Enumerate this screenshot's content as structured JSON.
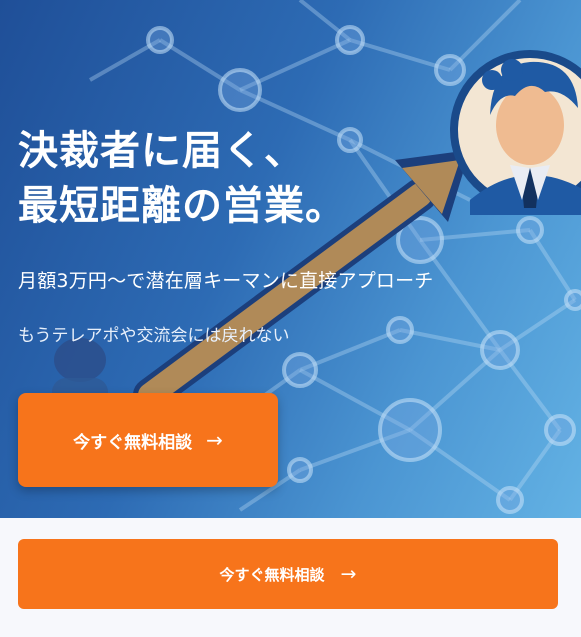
{
  "hero": {
    "title_lines": [
      "決裁者に届く、",
      "最短距離の営業。"
    ],
    "subtitle": "月額3万円〜で潜在層キーマンに直接アプローチ",
    "tagline": "もうテレアポや交流会には戻れない",
    "cta_label": "今すぐ無料相談",
    "cta_arrow": "→"
  },
  "sticky_bar": {
    "cta_label": "今すぐ無料相談",
    "cta_arrow": "→"
  },
  "colors": {
    "accent": "#f7741b",
    "hero_gradient_start": "#1f4f98",
    "hero_gradient_end": "#63b2e4"
  },
  "icons": [
    "network-graph-illustration",
    "growth-arrow-illustration",
    "businessman-avatar-icon",
    "person-illustration",
    "arrow-right-icon"
  ]
}
